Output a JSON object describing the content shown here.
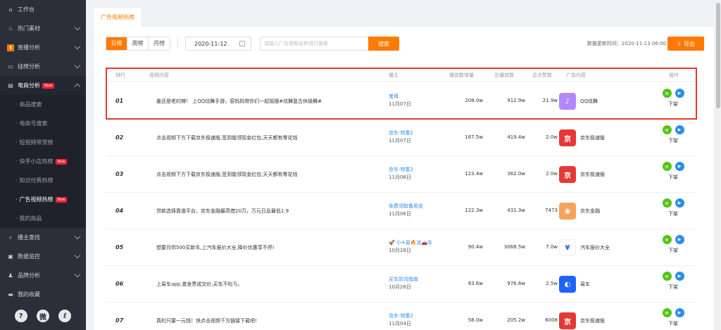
{
  "sidebar": {
    "items": [
      {
        "label": "工作台",
        "icon": "home-icon"
      },
      {
        "label": "热门素材",
        "icon": "fire-icon"
      },
      {
        "label": "直播分析",
        "icon": "chart-bar-icon"
      },
      {
        "label": "挂榜分析",
        "icon": "chart-line-icon"
      },
      {
        "label": "电商分析",
        "icon": "shop-icon",
        "badge": "New"
      }
    ],
    "sub_items": [
      {
        "label": "商品搜索"
      },
      {
        "label": "电商号搜索"
      },
      {
        "label": "短视频带货榜"
      },
      {
        "label": "快手小店热榜",
        "badge": "New"
      },
      {
        "label": "知识付费热榜"
      },
      {
        "label": "广告视频热榜",
        "badge": "New"
      },
      {
        "label": "我的商品"
      }
    ],
    "items_bottom": [
      {
        "label": "播主查找",
        "icon": "search-icon"
      },
      {
        "label": "数据监控",
        "icon": "monitor-icon"
      },
      {
        "label": "品牌分析",
        "icon": "brand-icon"
      },
      {
        "label": "我的收藏",
        "icon": "collect-icon"
      }
    ],
    "footer": [
      "?",
      "微",
      "ℓ"
    ]
  },
  "tab": {
    "label": "广告视频热榜"
  },
  "filters": {
    "periods": [
      "日榜",
      "周榜",
      "月榜"
    ],
    "date": "2020-11-12",
    "search_placeholder": "请输入广告视频名称进行搜索",
    "search_label": "搜索",
    "update_time": "数据更新时间：2020-11-13 06:00",
    "export_label": "导出"
  },
  "table": {
    "headers": {
      "rank": "排行",
      "content": "视频内容",
      "anchor": "播主",
      "inc": "播放数增量",
      "total": "总播放数",
      "likes": "总点赞数",
      "ad": "广告内容",
      "ops": "操作"
    },
    "rows": [
      {
        "rank": "01",
        "content": "姜还是老的辣！ 上QQ炫舞手游，容妈妈带你们一起摇摆#炫舞复古休操舞#",
        "anchor": "鬼哥",
        "date": "11月07日",
        "inc": "208.0w",
        "total": "912.9w",
        "likes": "21.9w",
        "ad": "QQ炫舞",
        "logo_color": "#b388ff",
        "op": "下架"
      },
      {
        "rank": "02",
        "content": "点击视频下方下载京东极速版,签到能领现金红包,天天都有零花钱",
        "anchor": "京东-特重2",
        "date": "11月07日",
        "inc": "167.5w",
        "total": "419.4w",
        "likes": "2.0w",
        "ad": "京东极速版",
        "logo_color": "#e53935",
        "op": "下架"
      },
      {
        "rank": "03",
        "content": "点击视频下方下载京东极速版,签到能领现金红包,天天都有零花钱",
        "anchor": "京东-特重2",
        "date": "11月08日",
        "inc": "123.4w",
        "total": "362.0w",
        "likes": "2.0w",
        "ad": "京东极速版",
        "logo_color": "#e53935",
        "op": "下架"
      },
      {
        "rank": "04",
        "content": "贷款选择靠谱平台，京东金融最高借20万，万元日息最低1.9",
        "anchor": "免费领取备用金",
        "date": "11月06日",
        "inc": "122.3w",
        "total": "431.3w",
        "likes": "7473",
        "ad": "京东金融",
        "logo_color": "#f5a25d",
        "op": "下架"
      },
      {
        "rank": "05",
        "content": "想要月供500买新车,上汽车报价大全,降价优惠享不停!",
        "anchor": "🚀 小✈易🔥说🚗车",
        "date": "10月28日",
        "inc": "90.4w",
        "total": "3068.5w",
        "likes": "7.0w",
        "ad": "汽车报价大全",
        "logo_color": "#ffffff",
        "op": "下架"
      },
      {
        "rank": "06",
        "content": "上易车app,查发票成交价,买车不吃亏。",
        "anchor": "买车防坑指南",
        "date": "10月28日",
        "inc": "83.6w",
        "total": "976.6w",
        "likes": "2.5w",
        "ad": "易车",
        "logo_color": "#1e63ff",
        "op": "下架"
      },
      {
        "rank": "07",
        "content": "真的只要一元钱！快点击视频下方链接下载吧!",
        "anchor": "京东-特重2",
        "date": "11月04日",
        "inc": "58.0w",
        "total": "205.2w",
        "likes": "6008",
        "ad": "京东极速版",
        "logo_color": "#e53935",
        "op": "下架"
      }
    ]
  }
}
